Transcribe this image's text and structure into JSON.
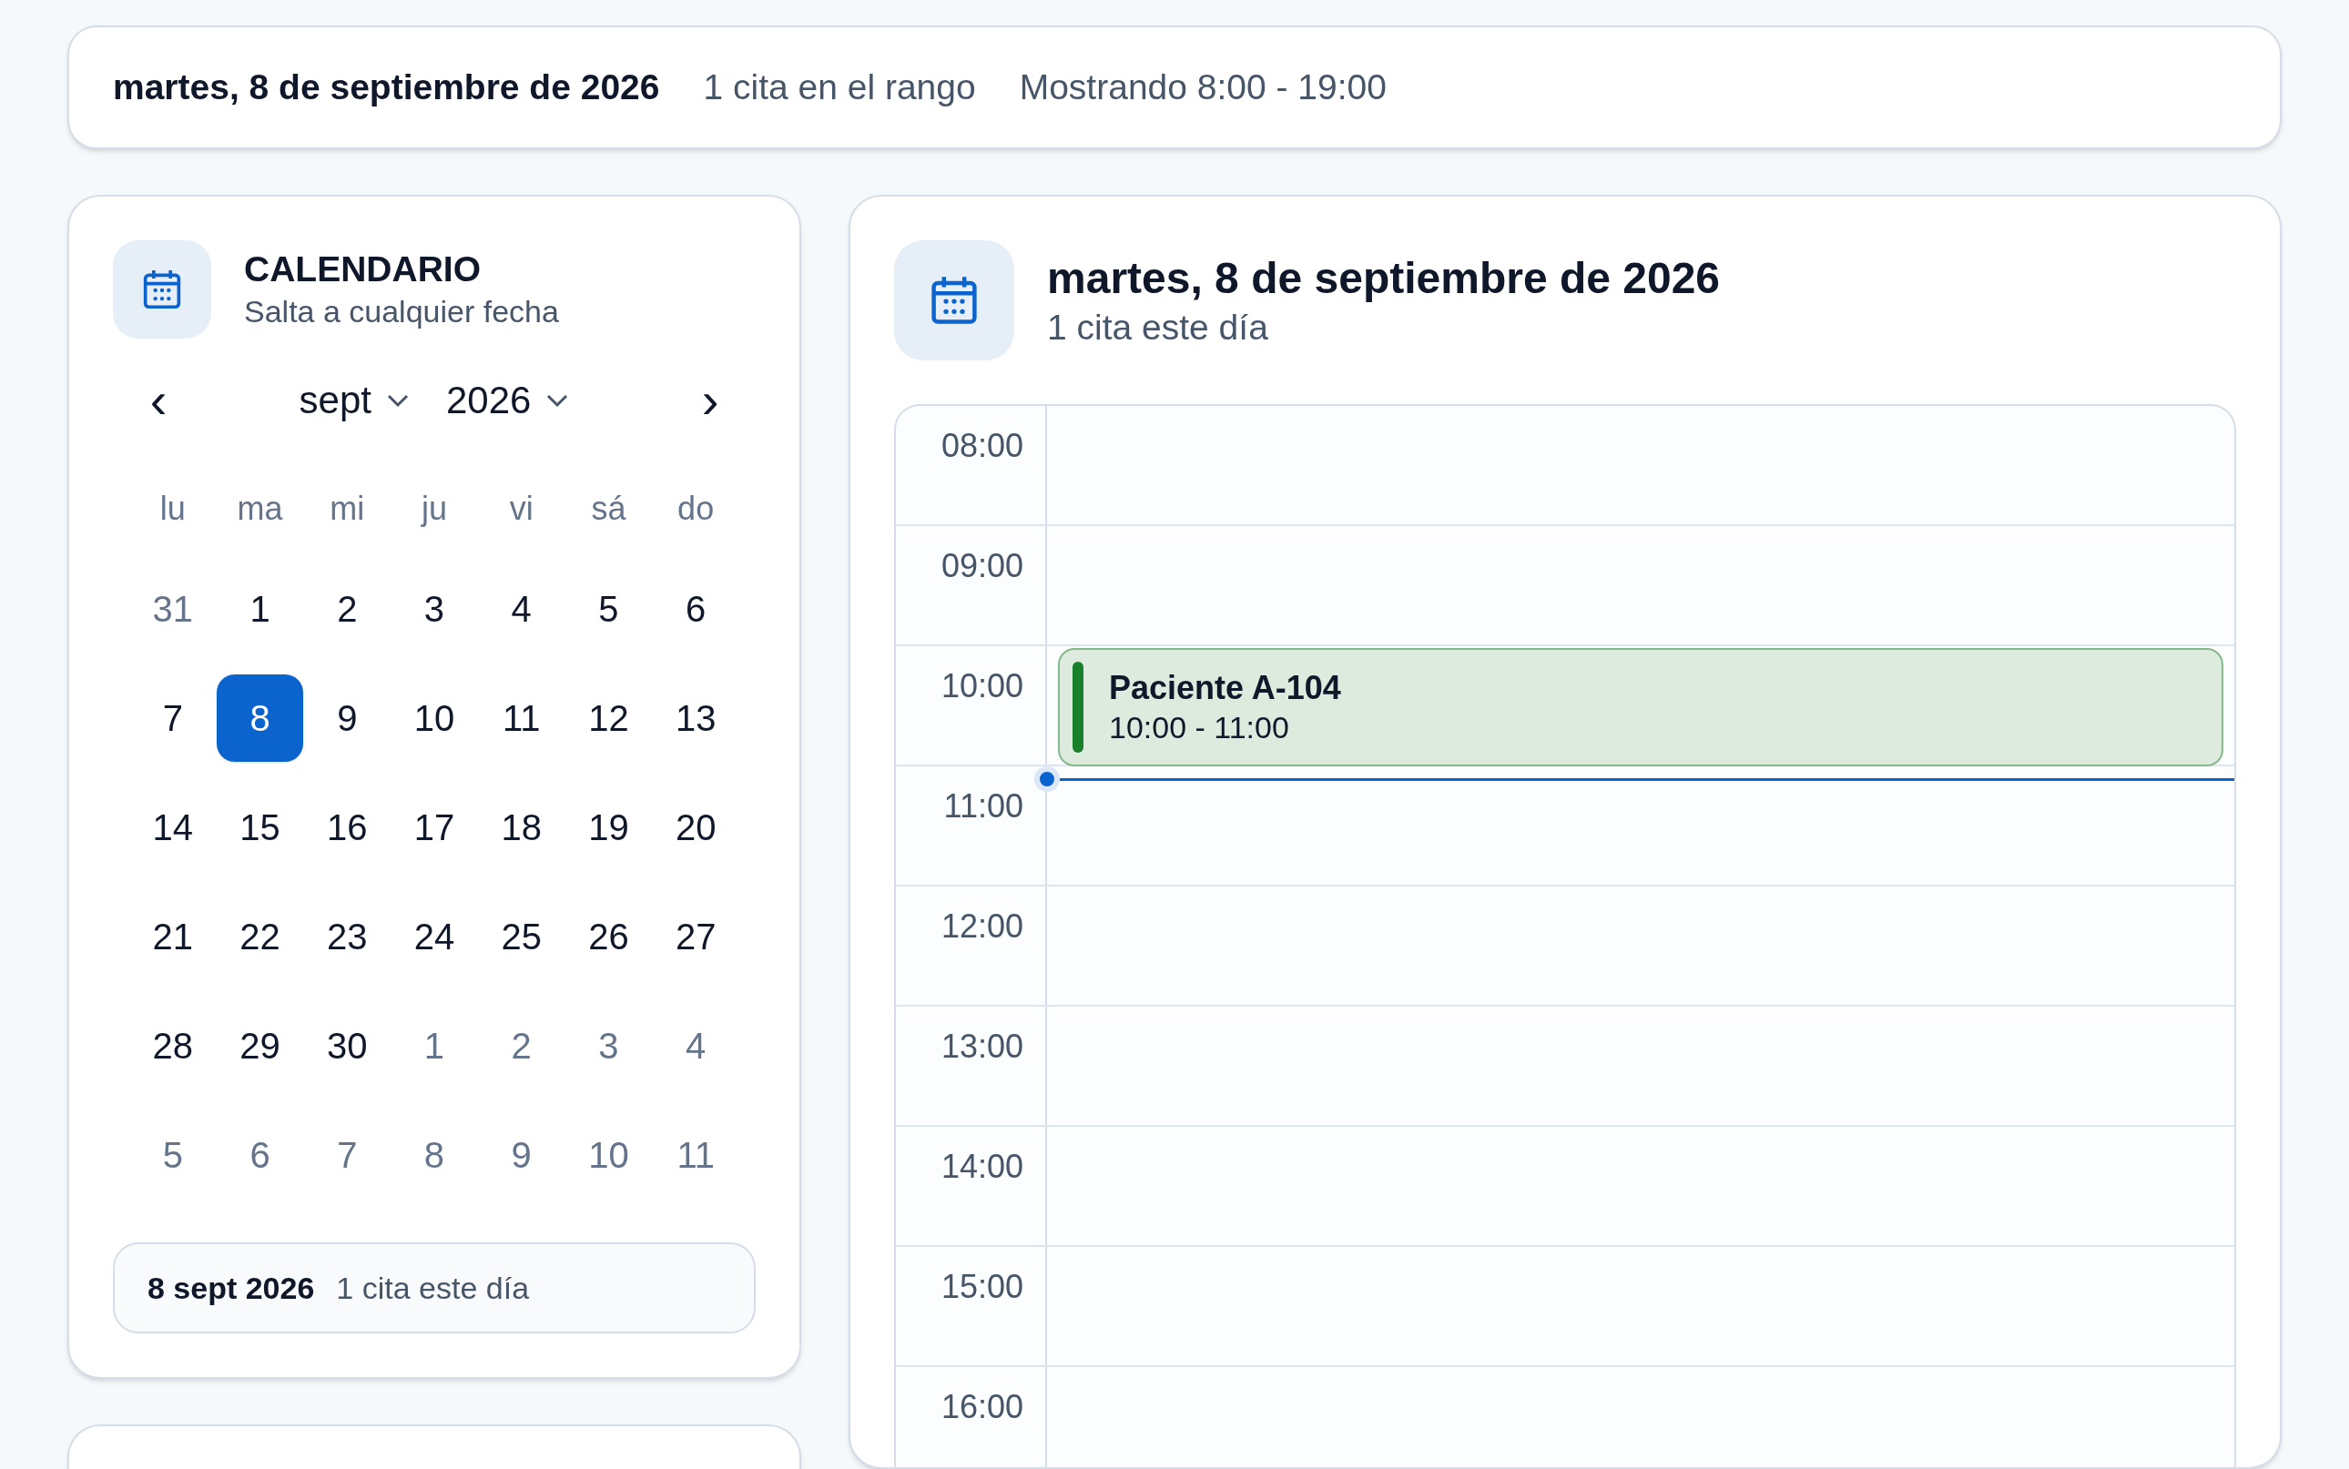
{
  "summary_bar": {
    "date": "martes, 8 de septiembre de 2026",
    "count": "1 cita en el rango",
    "range": "Mostrando 8:00 - 19:00"
  },
  "calendar": {
    "title": "CALENDARIO",
    "subtitle": "Salta a cualquier fecha",
    "month": "sept",
    "year": "2026",
    "prev": "‹",
    "next": "›",
    "weekdays": [
      "lu",
      "ma",
      "mi",
      "ju",
      "vi",
      "sá",
      "do"
    ],
    "weeks": [
      [
        {
          "label": "31",
          "in_month": false,
          "selected": false
        },
        {
          "label": "1",
          "in_month": true,
          "selected": false
        },
        {
          "label": "2",
          "in_month": true,
          "selected": false
        },
        {
          "label": "3",
          "in_month": true,
          "selected": false
        },
        {
          "label": "4",
          "in_month": true,
          "selected": false
        },
        {
          "label": "5",
          "in_month": true,
          "selected": false
        },
        {
          "label": "6",
          "in_month": true,
          "selected": false
        }
      ],
      [
        {
          "label": "7",
          "in_month": true,
          "selected": false
        },
        {
          "label": "8",
          "in_month": true,
          "selected": true
        },
        {
          "label": "9",
          "in_month": true,
          "selected": false
        },
        {
          "label": "10",
          "in_month": true,
          "selected": false
        },
        {
          "label": "11",
          "in_month": true,
          "selected": false
        },
        {
          "label": "12",
          "in_month": true,
          "selected": false
        },
        {
          "label": "13",
          "in_month": true,
          "selected": false
        }
      ],
      [
        {
          "label": "14",
          "in_month": true,
          "selected": false
        },
        {
          "label": "15",
          "in_month": true,
          "selected": false
        },
        {
          "label": "16",
          "in_month": true,
          "selected": false
        },
        {
          "label": "17",
          "in_month": true,
          "selected": false
        },
        {
          "label": "18",
          "in_month": true,
          "selected": false
        },
        {
          "label": "19",
          "in_month": true,
          "selected": false
        },
        {
          "label": "20",
          "in_month": true,
          "selected": false
        }
      ],
      [
        {
          "label": "21",
          "in_month": true,
          "selected": false
        },
        {
          "label": "22",
          "in_month": true,
          "selected": false
        },
        {
          "label": "23",
          "in_month": true,
          "selected": false
        },
        {
          "label": "24",
          "in_month": true,
          "selected": false
        },
        {
          "label": "25",
          "in_month": true,
          "selected": false
        },
        {
          "label": "26",
          "in_month": true,
          "selected": false
        },
        {
          "label": "27",
          "in_month": true,
          "selected": false
        }
      ],
      [
        {
          "label": "28",
          "in_month": true,
          "selected": false
        },
        {
          "label": "29",
          "in_month": true,
          "selected": false
        },
        {
          "label": "30",
          "in_month": true,
          "selected": false
        },
        {
          "label": "1",
          "in_month": false,
          "selected": false
        },
        {
          "label": "2",
          "in_month": false,
          "selected": false
        },
        {
          "label": "3",
          "in_month": false,
          "selected": false
        },
        {
          "label": "4",
          "in_month": false,
          "selected": false
        }
      ],
      [
        {
          "label": "5",
          "in_month": false,
          "selected": false
        },
        {
          "label": "6",
          "in_month": false,
          "selected": false
        },
        {
          "label": "7",
          "in_month": false,
          "selected": false
        },
        {
          "label": "8",
          "in_month": false,
          "selected": false
        },
        {
          "label": "9",
          "in_month": false,
          "selected": false
        },
        {
          "label": "10",
          "in_month": false,
          "selected": false
        },
        {
          "label": "11",
          "in_month": false,
          "selected": false
        }
      ]
    ],
    "footer": {
      "date": "8 sept 2026",
      "count": "1 cita este día"
    }
  },
  "day_view": {
    "title": "martes, 8 de septiembre de 2026",
    "subtitle": "1 cita este día",
    "hours": [
      {
        "label": "08:00"
      },
      {
        "label": "09:00"
      },
      {
        "label": "10:00",
        "events": [
          {
            "title": "Paciente A-104",
            "time": "10:00 - 11:00",
            "color": "#1a7f2a"
          }
        ]
      },
      {
        "label": "11:00"
      },
      {
        "label": "12:00"
      },
      {
        "label": "13:00"
      },
      {
        "label": "14:00"
      },
      {
        "label": "15:00"
      },
      {
        "label": "16:00"
      }
    ]
  }
}
